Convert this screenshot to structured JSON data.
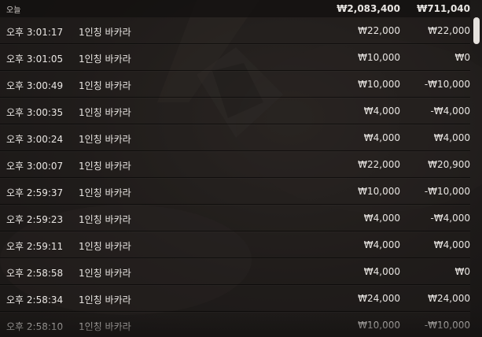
{
  "summary": {
    "label": "오늘",
    "total_bet": "₩2,083,400",
    "net_result": "₩711,040"
  },
  "rows": [
    {
      "time": "오후 3:01:17",
      "game": "1인칭 바카라",
      "bet": "₩22,000",
      "result": "₩22,000"
    },
    {
      "time": "오후 3:01:05",
      "game": "1인칭 바카라",
      "bet": "₩10,000",
      "result": "₩0"
    },
    {
      "time": "오후 3:00:49",
      "game": "1인칭 바카라",
      "bet": "₩10,000",
      "result": "-₩10,000"
    },
    {
      "time": "오후 3:00:35",
      "game": "1인칭 바카라",
      "bet": "₩4,000",
      "result": "-₩4,000"
    },
    {
      "time": "오후 3:00:24",
      "game": "1인칭 바카라",
      "bet": "₩4,000",
      "result": "₩4,000"
    },
    {
      "time": "오후 3:00:07",
      "game": "1인칭 바카라",
      "bet": "₩22,000",
      "result": "₩20,900"
    },
    {
      "time": "오후 2:59:37",
      "game": "1인칭 바카라",
      "bet": "₩10,000",
      "result": "-₩10,000"
    },
    {
      "time": "오후 2:59:23",
      "game": "1인칭 바카라",
      "bet": "₩4,000",
      "result": "-₩4,000"
    },
    {
      "time": "오후 2:59:11",
      "game": "1인칭 바카라",
      "bet": "₩4,000",
      "result": "₩4,000"
    },
    {
      "time": "오후 2:58:58",
      "game": "1인칭 바카라",
      "bet": "₩4,000",
      "result": "₩0"
    },
    {
      "time": "오후 2:58:34",
      "game": "1인칭 바카라",
      "bet": "₩24,000",
      "result": "₩24,000"
    },
    {
      "time": "오후 2:58:10",
      "game": "1인칭 바카라",
      "bet": "₩10,000",
      "result": "-₩10,000"
    }
  ],
  "colors": {
    "text": "#e9e6e3",
    "background": "#1a1716",
    "scrollbar_thumb": "#e6e2de"
  }
}
